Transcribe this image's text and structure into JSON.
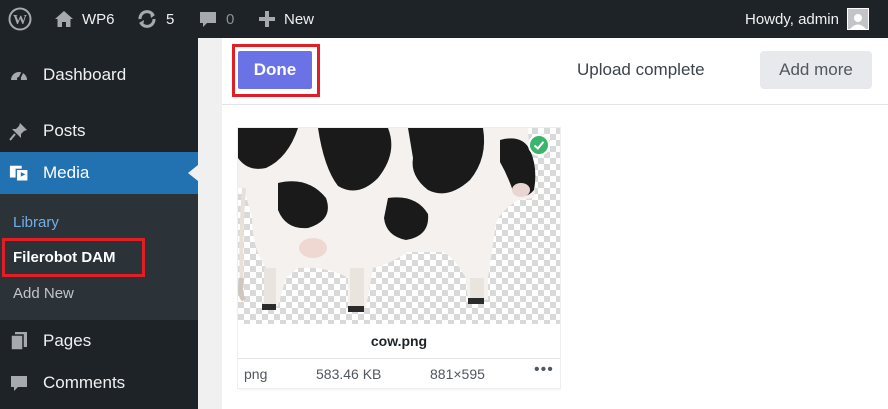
{
  "adminbar": {
    "site_name": "WP6",
    "updates_count": "5",
    "comments_count": "0",
    "new_label": "New",
    "greeting": "Howdy, admin"
  },
  "sidebar": {
    "items": [
      {
        "label": "Dashboard"
      },
      {
        "label": "Posts"
      },
      {
        "label": "Media"
      },
      {
        "label": "Pages"
      },
      {
        "label": "Comments"
      }
    ],
    "submenu": [
      {
        "label": "Library"
      },
      {
        "label": "Filerobot DAM"
      },
      {
        "label": "Add New"
      }
    ]
  },
  "upload": {
    "done_label": "Done",
    "status": "Upload complete",
    "add_more_label": "Add more"
  },
  "file": {
    "name": "cow.png",
    "type": "png",
    "size": "583.46 KB",
    "dimensions": "881×595",
    "more": "•••"
  },
  "colors": {
    "adminbar_bg": "#1d2327",
    "active_menu": "#2271b1",
    "done_button": "#6b72e6",
    "highlight": "#e11d26",
    "success": "#3bb46d"
  }
}
